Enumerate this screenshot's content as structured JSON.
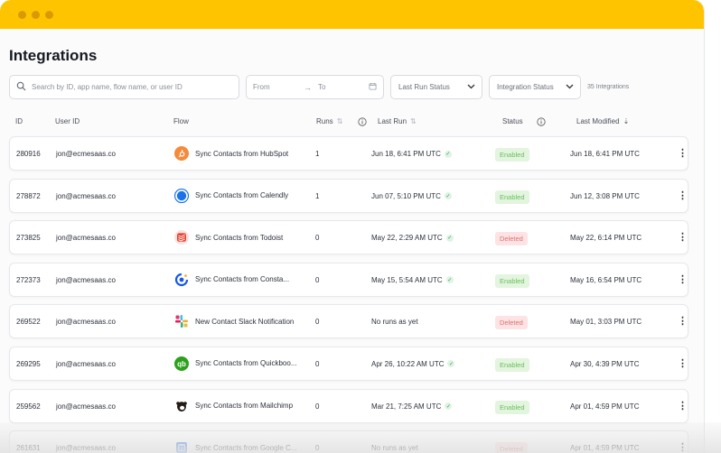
{
  "page_title": "Integrations",
  "search": {
    "placeholder": "Search by ID, app name, flow name, or user ID"
  },
  "date_range": {
    "from": "From",
    "to": "To"
  },
  "filters": {
    "last_run_status": "Last Run Status",
    "integration_status": "Integration Status"
  },
  "count_label": "35 Integrations",
  "columns": {
    "id": "ID",
    "user_id": "User ID",
    "flow": "Flow",
    "runs": "Runs",
    "last_run": "Last Run",
    "status": "Status",
    "last_modified": "Last Modified"
  },
  "colors": {
    "accent": "#ffc400",
    "enabled": "#6bbf5d",
    "deleted": "#e07070"
  },
  "rows": [
    {
      "id": "280916",
      "user": "jon@ecmesaas.co",
      "icon": "hubspot-icon",
      "flow": "Sync Contacts from HubSpot",
      "runs": "1",
      "last_run": "Jun 18, 6:41 PM UTC",
      "ok": true,
      "status": "Enabled",
      "modified": "Jun 18, 6:41 PM UTC"
    },
    {
      "id": "278872",
      "user": "jon@acmesaas.co",
      "icon": "calendly-icon",
      "flow": "Sync Contacts from Calendly",
      "runs": "1",
      "last_run": "Jun 07, 5:10 PM UTC",
      "ok": true,
      "status": "Enabled",
      "modified": "Jun 12, 3:08 PM UTC"
    },
    {
      "id": "273825",
      "user": "jon@acmesaas.co",
      "icon": "todoist-icon",
      "flow": "Sync Contacts from Todoist",
      "runs": "0",
      "last_run": "May 22, 2:29 AM UTC",
      "ok": true,
      "status": "Deleted",
      "modified": "May 22, 6:14 PM UTC"
    },
    {
      "id": "272373",
      "user": "jon@acmesaas.co",
      "icon": "constant-contact-icon",
      "flow": "Sync Contacts from Consta...",
      "runs": "0",
      "last_run": "May 15, 5:54 AM UTC",
      "ok": true,
      "status": "Enabled",
      "modified": "May 16, 6:54 PM UTC"
    },
    {
      "id": "269522",
      "user": "jon@acmesaas.co",
      "icon": "slack-icon",
      "flow": "New Contact Slack Notification",
      "runs": "0",
      "last_run": "No runs as yet",
      "ok": false,
      "status": "Deleted",
      "modified": "May 01, 3:03 PM UTC"
    },
    {
      "id": "269295",
      "user": "jon@acmesaas.co",
      "icon": "quickbooks-icon",
      "flow": "Sync Contacts from Quickboo...",
      "runs": "0",
      "last_run": "Apr 26, 10:22 AM UTC",
      "ok": true,
      "status": "Enabled",
      "modified": "Apr 30, 4:39 PM UTC"
    },
    {
      "id": "259562",
      "user": "jon@acmesaas.co",
      "icon": "mailchimp-icon",
      "flow": "Sync Contacts from Mailchimp",
      "runs": "0",
      "last_run": "Mar 21, 7:25 AM UTC",
      "ok": true,
      "status": "Enabled",
      "modified": "Apr 01, 4:59 PM UTC"
    },
    {
      "id": "261631",
      "user": "jon@acmesaas.co",
      "icon": "google-contacts-icon",
      "flow": "Sync Contacts from Google C...",
      "runs": "0",
      "last_run": "No runs as yet",
      "ok": false,
      "status": "Deleted",
      "modified": "Apr 01, 4:59 PM UTC"
    }
  ]
}
